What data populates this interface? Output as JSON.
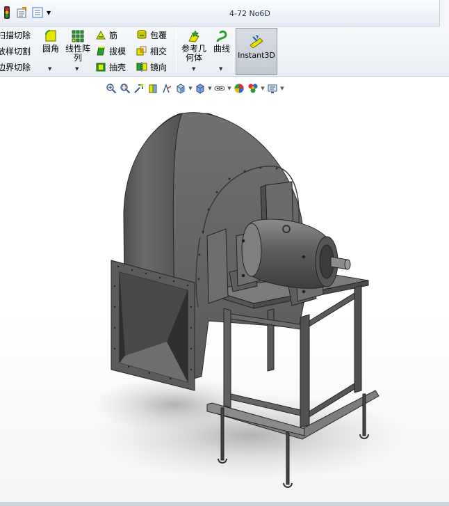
{
  "app": {
    "document_title": "4-72 No6D"
  },
  "quick_access": [
    {
      "name": "traffic-light-icon"
    },
    {
      "name": "options-icon"
    },
    {
      "name": "list-icon"
    }
  ],
  "ribbon": {
    "cut_group": [
      {
        "label": "扫描切除",
        "icon": "sweep-cut-icon"
      },
      {
        "label": "放样切割",
        "icon": "loft-cut-icon"
      },
      {
        "label": "边界切除",
        "icon": "boundary-cut-icon"
      }
    ],
    "fillet": {
      "label": "圆角",
      "icon": "fillet-icon"
    },
    "linear_pattern": {
      "label_line1": "线性阵",
      "label_line2": "列",
      "icon": "linear-pattern-icon"
    },
    "feature_col1": [
      {
        "label": "筋",
        "icon": "rib-icon"
      },
      {
        "label": "拔模",
        "icon": "draft-icon"
      },
      {
        "label": "抽壳",
        "icon": "shell-icon"
      }
    ],
    "feature_col2": [
      {
        "label": "包覆",
        "icon": "wrap-icon"
      },
      {
        "label": "相交",
        "icon": "intersect-icon"
      },
      {
        "label": "镜向",
        "icon": "mirror-icon"
      }
    ],
    "reference_geometry": {
      "label_line1": "参考几",
      "label_line2": "何体",
      "icon": "reference-geometry-icon"
    },
    "curves": {
      "label": "曲线",
      "icon": "curves-icon"
    },
    "instant3d": {
      "label": "Instant3D",
      "icon": "instant3d-icon"
    }
  },
  "heads_up_toolbar": [
    {
      "name": "zoom-to-fit-icon"
    },
    {
      "name": "zoom-to-area-icon"
    },
    {
      "name": "previous-view-icon"
    },
    {
      "name": "section-view-icon"
    },
    {
      "name": "dynamic-annotation-icon"
    },
    {
      "name": "view-orientation-icon",
      "dropdown": true
    },
    {
      "name": "display-style-icon",
      "dropdown": true
    },
    {
      "name": "hide-show-items-icon",
      "dropdown": true
    },
    {
      "name": "edit-appearance-icon"
    },
    {
      "name": "apply-scene-icon",
      "dropdown": true
    },
    {
      "name": "view-settings-icon",
      "dropdown": true
    }
  ],
  "colors": {
    "model_body": "#5e5f61",
    "model_dark": "#3f4042",
    "model_light": "#8a8b8d",
    "ribbon_bg": "#eef1f5",
    "active_button": "#c8ced6"
  }
}
